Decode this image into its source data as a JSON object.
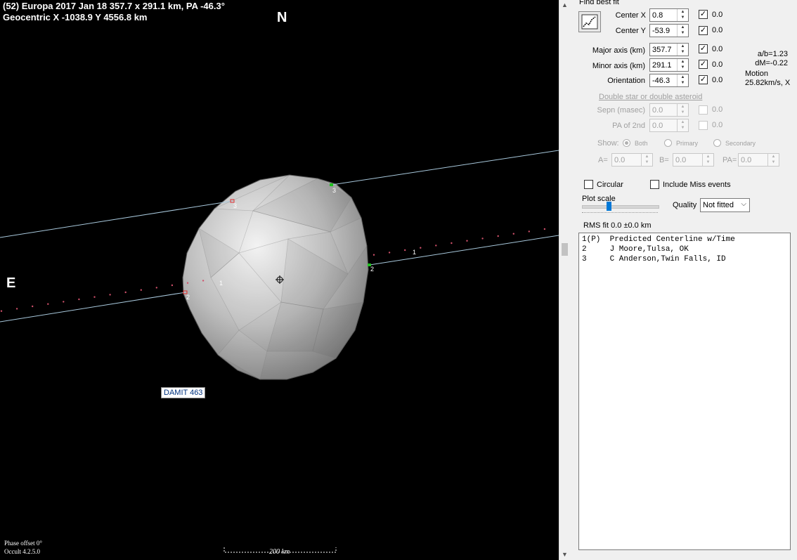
{
  "plot": {
    "title_line1": "(52) Europa  2017 Jan 18  357.7 x 291.1 km, PA -46.3°",
    "title_line2": "Geocentric  X  -1038.9  Y 4556.8 km",
    "north_label": "N",
    "east_label": "E",
    "model_label": "DAMIT 463",
    "phase_offset": "Phase offset 0°",
    "version": "Occult 4.2.5.0",
    "scale_label": "200 km",
    "chord_labels": [
      "3",
      "3",
      "1",
      "2",
      "2",
      "1"
    ],
    "colors": {
      "background": "#000000",
      "chord": "#a8c8dc",
      "centerline": "#d0506a",
      "disappear": "#e03030",
      "reappear": "#20c020",
      "model_label_text": "#00327f"
    }
  },
  "panel": {
    "find_best_fit": "Find best fit",
    "center_x": {
      "label": "Center X",
      "value": "0.8",
      "fit": "0.0",
      "checked": true
    },
    "center_y": {
      "label": "Center Y",
      "value": "-53.9",
      "fit": "0.0",
      "checked": true
    },
    "major_axis": {
      "label": "Major axis (km)",
      "value": "357.7",
      "fit": "0.0",
      "checked": true
    },
    "minor_axis": {
      "label": "Minor axis (km)",
      "value": "291.1",
      "fit": "0.0",
      "checked": true
    },
    "orientation": {
      "label": "Orientation",
      "value": "-46.3",
      "fit": "0.0",
      "checked": true
    },
    "ab_ratio": "a/b=1.23",
    "dm": "dM=-0.22",
    "motion_label": "Motion",
    "motion_value": "25.82km/s, X",
    "double_star_link": "Double star  or  double asteroid",
    "sepn": {
      "label": "Sepn (masec)",
      "value": "0.0",
      "fit": "0.0"
    },
    "pa2": {
      "label": "PA of 2nd",
      "value": "0.0",
      "fit": "0.0"
    },
    "show_label": "Show:",
    "show_options": [
      "Both",
      "Primary",
      "Secondary"
    ],
    "a_field": {
      "label": "A=",
      "value": "0.0"
    },
    "b_field": {
      "label": "B=",
      "value": "0.0"
    },
    "pa_field": {
      "label": "PA=",
      "value": "0.0"
    },
    "circular_label": "Circular",
    "include_miss_label": "Include Miss events",
    "plot_scale_label": "Plot scale",
    "plot_scale_fraction": 0.35,
    "quality_label": "Quality",
    "quality_value": "Not fitted",
    "rms_fit": "RMS fit 0.0 ±0.0 km",
    "observers": [
      "1(P)  Predicted Centerline w/Time",
      "2     J Moore,Tulsa, OK",
      "3     C Anderson,Twin Falls, ID"
    ]
  }
}
